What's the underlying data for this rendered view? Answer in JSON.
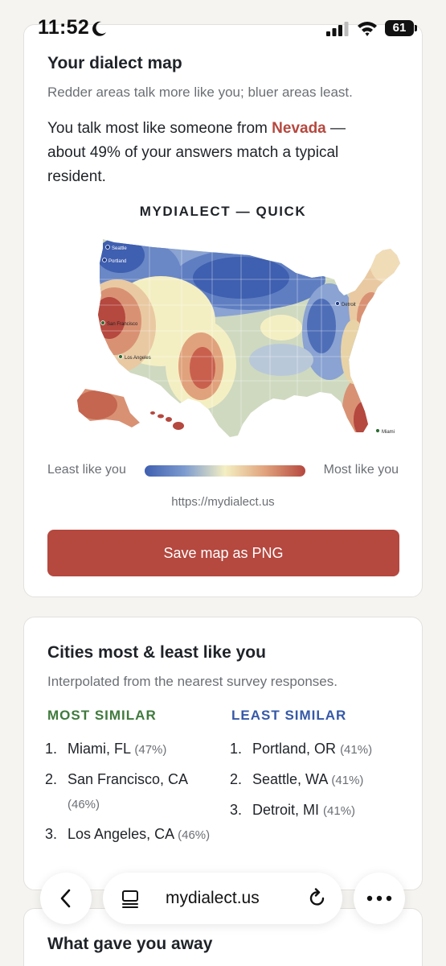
{
  "status_bar": {
    "time": "11:52",
    "battery": "61"
  },
  "map_card": {
    "title": "Your dialect map",
    "subtitle": "Redder areas talk more like you; bluer areas least.",
    "result_prefix": "You talk most like someone from ",
    "result_state": "Nevada",
    "result_suffix": " — about 49% of your answers match a typical resident.",
    "map_heading": "MYDIALECT — QUICK",
    "map_city_labels": [
      "Seattle",
      "Portland",
      "San Francisco",
      "Los Angeles",
      "Detroit",
      "Miami"
    ],
    "legend_least": "Least like you",
    "legend_most": "Most like you",
    "url": "https://mydialect.us",
    "save_label": "Save map as PNG"
  },
  "cities_card": {
    "title": "Cities most & least like you",
    "subtitle": "Interpolated from the nearest survey responses.",
    "most_heading": "MOST SIMILAR",
    "least_heading": "LEAST SIMILAR",
    "most": [
      {
        "num": "1.",
        "city": "Miami, FL",
        "pct": "(47%)"
      },
      {
        "num": "2.",
        "city": "San Francisco, CA",
        "pct": "(46%)"
      },
      {
        "num": "3.",
        "city": "Los Angeles, CA",
        "pct": "(46%)"
      }
    ],
    "least": [
      {
        "num": "1.",
        "city": "Portland, OR",
        "pct": "(41%)"
      },
      {
        "num": "2.",
        "city": "Seattle, WA",
        "pct": "(41%)"
      },
      {
        "num": "3.",
        "city": "Detroit, MI",
        "pct": "(41%)"
      }
    ]
  },
  "away_card": {
    "title": "What gave you away"
  },
  "browser_bar": {
    "url": "mydialect.us"
  },
  "colors": {
    "accent_red": "#b5483f",
    "most_green": "#3f7a3c",
    "least_blue": "#3558a8",
    "map_blue": "#3f5fb0",
    "map_yellow": "#f4efc3"
  }
}
